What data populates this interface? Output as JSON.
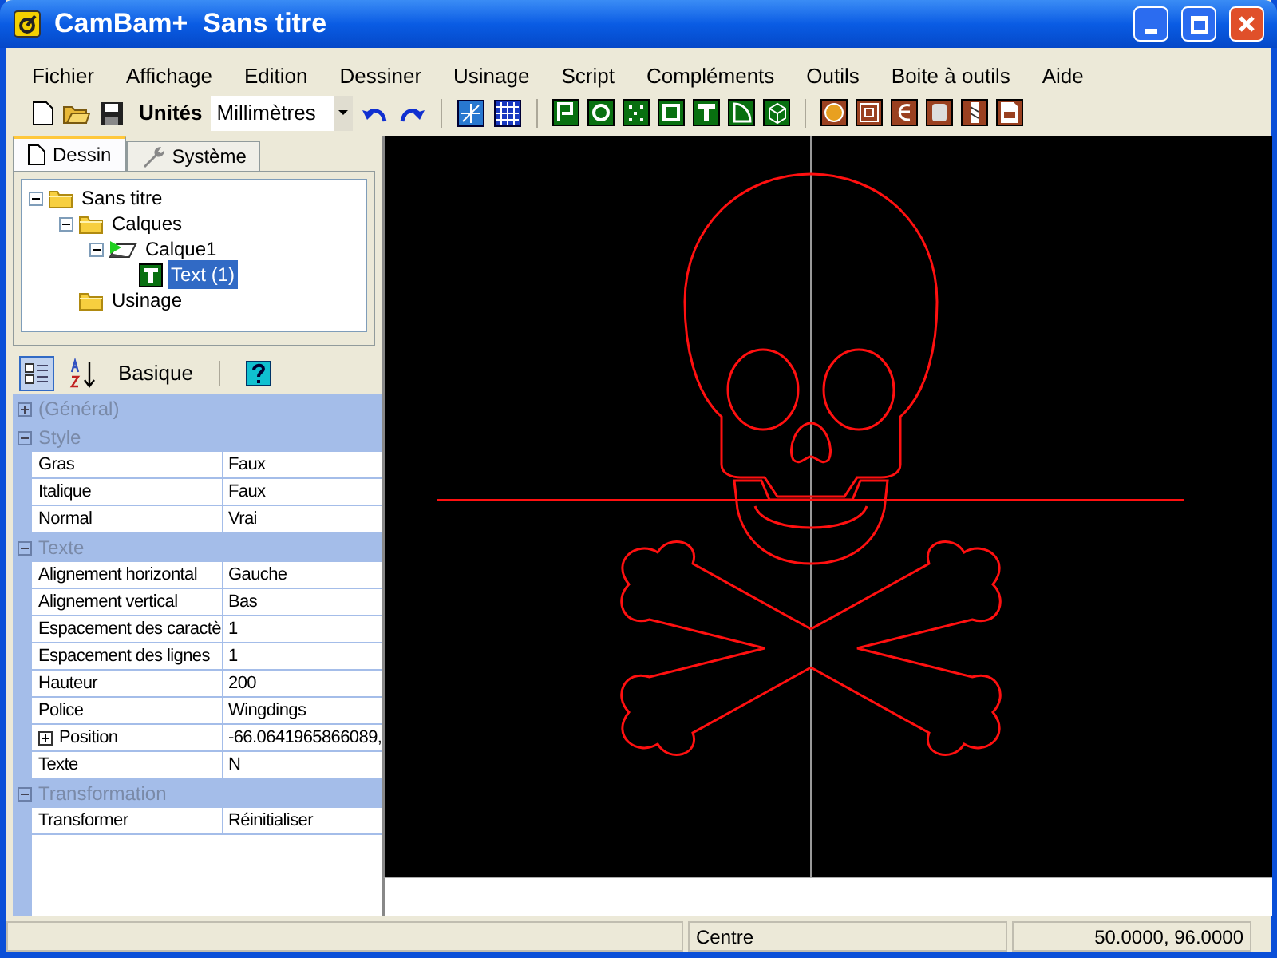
{
  "window": {
    "title": "CamBam+  Sans titre"
  },
  "menu": [
    "Fichier",
    "Affichage",
    "Edition",
    "Dessiner",
    "Usinage",
    "Script",
    "Compléments",
    "Outils",
    "Boite à outils",
    "Aide"
  ],
  "toolbar": {
    "units_label": "Unités",
    "units_value": "Millimètres"
  },
  "tabs": [
    {
      "label": "Dessin",
      "selected": true
    },
    {
      "label": "Système",
      "selected": false
    }
  ],
  "tree": [
    {
      "label": "Sans titre",
      "kind": "folder",
      "expanded": true,
      "selected": false,
      "children": [
        {
          "label": "Calques",
          "kind": "folder",
          "expanded": true,
          "selected": false,
          "children": [
            {
              "label": "Calque1",
              "kind": "layer",
              "expanded": true,
              "selected": false,
              "children": [
                {
                  "label": "Text (1)",
                  "kind": "text",
                  "selected": true
                }
              ]
            }
          ]
        },
        {
          "label": "Usinage",
          "kind": "folder",
          "selected": false
        }
      ]
    }
  ],
  "properties_toolbar": {
    "mode_label": "Basique"
  },
  "properties": [
    {
      "category": "(Général)",
      "expanded": false
    },
    {
      "category": "Style",
      "expanded": true,
      "rows": [
        {
          "name": "Gras",
          "value": "Faux"
        },
        {
          "name": "Italique",
          "value": "Faux"
        },
        {
          "name": "Normal",
          "value": "Vrai"
        }
      ]
    },
    {
      "category": "Texte",
      "expanded": true,
      "rows": [
        {
          "name": "Alignement horizontal",
          "value": "Gauche"
        },
        {
          "name": "Alignement vertical",
          "value": "Bas"
        },
        {
          "name": "Espacement des caractè",
          "value": "1"
        },
        {
          "name": "Espacement des lignes",
          "value": "1"
        },
        {
          "name": "Hauteur",
          "value": "200"
        },
        {
          "name": "Police",
          "value": "Wingdings"
        },
        {
          "name": "Position",
          "value": "-66.0641965866089,",
          "expanded": false
        },
        {
          "name": "Texte",
          "value": "N"
        }
      ]
    },
    {
      "category": "Transformation",
      "expanded": true,
      "rows": [
        {
          "name": "Transformer",
          "value": "Réinitialiser"
        }
      ]
    }
  ],
  "status_bar": {
    "pane_2": "Centre",
    "pane_3": "50.0000, 96.0000"
  }
}
